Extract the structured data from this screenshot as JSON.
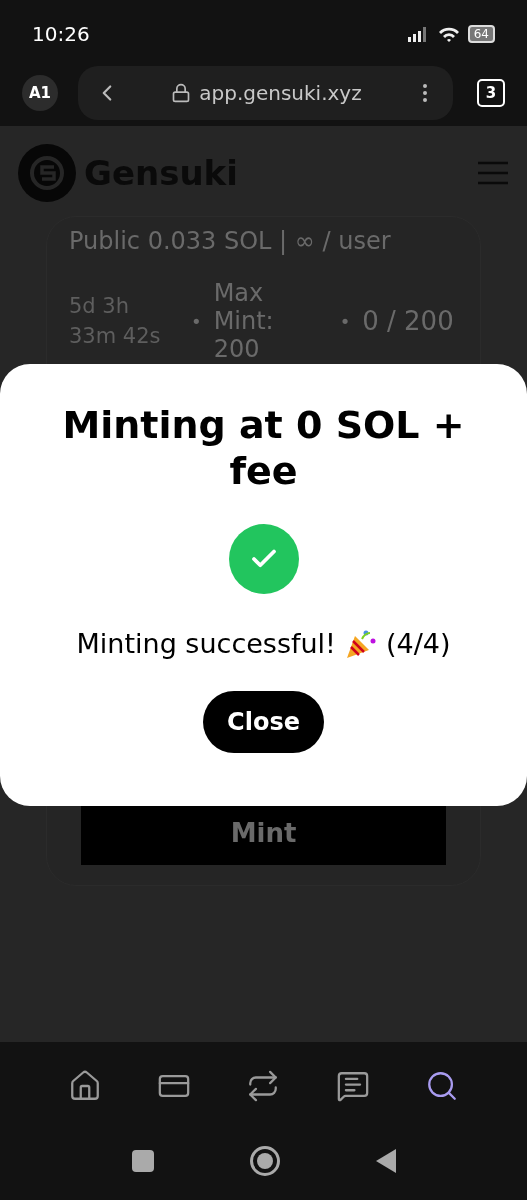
{
  "status_bar": {
    "time": "10:26",
    "battery": "64"
  },
  "browser": {
    "profile": "A1",
    "url": "app.gensuki.xyz",
    "tab_count": "3"
  },
  "site": {
    "brand": "Gensuki"
  },
  "mint_card": {
    "phase": "Public 0.033 SOL | ∞ / user",
    "countdown": "5d 3h 33m 42s",
    "separator": "•",
    "max_mint": "Max Mint: 200",
    "minted": "0 / 200",
    "button": "Mint"
  },
  "modal": {
    "title": "Minting at 0 SOL + fee",
    "success": true,
    "message": "Minting successful!",
    "progress": "(4/4)",
    "button": "Close"
  },
  "bottom_nav": [
    {
      "kind": "home",
      "selected": false
    },
    {
      "kind": "wallet",
      "selected": false
    },
    {
      "kind": "swap",
      "selected": false
    },
    {
      "kind": "chat",
      "selected": false
    },
    {
      "kind": "search",
      "selected": true
    }
  ]
}
